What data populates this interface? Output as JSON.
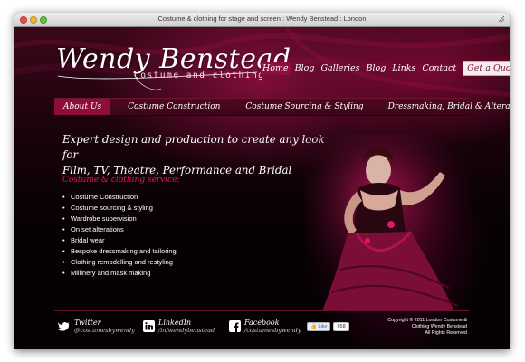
{
  "window": {
    "title": "Costume & clothing for stage and screen : Wendy Benstead : London"
  },
  "logo": {
    "name": "Wendy Benstead",
    "tagline": "costume and clothing"
  },
  "top_nav": [
    {
      "label": "Home"
    },
    {
      "label": "Blog"
    },
    {
      "label": "Galleries"
    },
    {
      "label": "Blog"
    },
    {
      "label": "Links"
    },
    {
      "label": "Contact"
    }
  ],
  "quote_button": "Get a Quote",
  "main_nav": [
    {
      "label": "About Us"
    },
    {
      "label": "Costume Construction"
    },
    {
      "label": "Costume Sourcing & Styling"
    },
    {
      "label": "Dressmaking, Bridal & Alterations"
    }
  ],
  "headline": {
    "line1": "Expert design and production to create any look for",
    "line2": "Film, TV, Theatre, Performance and Bridal"
  },
  "services": {
    "title": "Costume & clothing service:",
    "items": [
      "Costume Construction",
      "Costume sourcing & styling",
      "Wardrobe supervision",
      "On set alterations",
      "Bridal wear",
      "Bespoke dressmaking and tailoring",
      "Clothing remodelling and restyling",
      "Millinery and mask making"
    ]
  },
  "social": {
    "twitter": {
      "name": "Twitter",
      "handle": "@costumesbywendy"
    },
    "linkedin": {
      "name": "LinkedIn",
      "handle": "/in/wendybenstead"
    },
    "facebook": {
      "name": "Facebook",
      "handle": "/costumesbywendy"
    }
  },
  "like": {
    "label": "Like",
    "count": "658"
  },
  "copyright": {
    "line1": "Copyright © 2011 London Costume &",
    "line2": "Clothing Wendy Benstead",
    "line3": "All Rights Reserved"
  },
  "colors": {
    "accent": "#8e0d3b",
    "service_title": "#e0176a",
    "background": "#0a0205"
  },
  "icons": [
    "close-icon",
    "minimize-icon",
    "maximize-icon",
    "resize-icon",
    "twitter-bird-icon",
    "linkedin-icon",
    "facebook-icon",
    "facebook-like-icon",
    "bullet-icon"
  ]
}
